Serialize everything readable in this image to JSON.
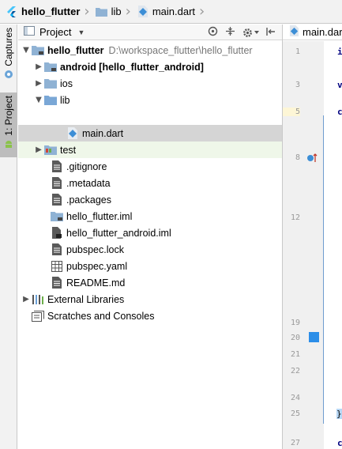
{
  "breadcrumb": [
    {
      "label": "hello_flutter",
      "icon": "flutter-logo-icon",
      "bold": true
    },
    {
      "label": "lib",
      "icon": "folder-icon",
      "bold": false
    },
    {
      "label": "main.dart",
      "icon": "dart-file-icon",
      "bold": false
    }
  ],
  "toolstrip": {
    "captures_label": "Captures",
    "project_label": "1: Project"
  },
  "panel": {
    "title": "Project",
    "dropdown_glyph": "▼"
  },
  "tree": {
    "root_label": "hello_flutter",
    "root_path": "D:\\workspace_flutter\\hello_flutter",
    "items": [
      {
        "label": "android [hello_flutter_android]"
      },
      {
        "label": "ios"
      },
      {
        "label": "lib"
      },
      {
        "label": "main.dart"
      },
      {
        "label": "test"
      },
      {
        "label": ".gitignore"
      },
      {
        "label": ".metadata"
      },
      {
        "label": ".packages"
      },
      {
        "label": "hello_flutter.iml"
      },
      {
        "label": "hello_flutter_android.iml"
      },
      {
        "label": "pubspec.lock"
      },
      {
        "label": "pubspec.yaml"
      },
      {
        "label": "README.md"
      },
      {
        "label": "External Libraries"
      },
      {
        "label": "Scratches and Consoles"
      }
    ]
  },
  "editor": {
    "tab_label": "main.dart",
    "line_numbers": [
      "1",
      "",
      "3",
      "",
      "5",
      "",
      "",
      "8",
      "",
      "",
      "",
      "12",
      "",
      "",
      "",
      "",
      "",
      "",
      "19",
      "20",
      "21",
      "22",
      "",
      "24",
      "25",
      "",
      "27"
    ],
    "code_fragments": [
      "i",
      "v",
      "c",
      "}",
      "c"
    ]
  },
  "colors": {
    "folder": "#8fb2d4",
    "dart": "#3c8ed6",
    "selection": "#d5d5d5",
    "test_bg": "#eff7e9",
    "run_marker": "#2c8ee8",
    "modified_bar": "#6e9ccf"
  }
}
